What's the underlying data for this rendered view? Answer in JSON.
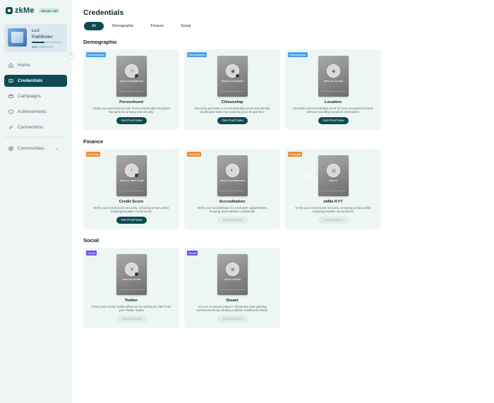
{
  "app": {
    "logo_text": "zkMe",
    "logo_badge": "Identity Hub"
  },
  "profile": {
    "level": "Lv.3",
    "rank": "Pathfinder",
    "xp_current": "423",
    "xp_total": "/1000 EXP",
    "xp_progress": 0.42
  },
  "sidebar": {
    "items": [
      {
        "label": "Home",
        "icon": "home-icon"
      },
      {
        "label": "Credentials",
        "icon": "id-card-icon"
      },
      {
        "label": "Campaigns",
        "icon": "flag-icon"
      },
      {
        "label": "Achievements",
        "icon": "shield-icon"
      },
      {
        "label": "Connections",
        "icon": "link-icon"
      }
    ],
    "communities": {
      "label": "Communities",
      "icon": "globe-icon"
    }
  },
  "page": {
    "title": "Credentials",
    "tabs": [
      "All",
      "Demographic",
      "Finance",
      "Social"
    ],
    "active_tab": "All"
  },
  "sections": [
    {
      "title": "Demographic",
      "cards": [
        {
          "tag": "Demographic",
          "sbt_label": "PROOF OF PERSONHOOD",
          "name": "Personhood",
          "desc": "Verify your personhood with homomorphically encrypted faceprint for privacy and security",
          "button": "Get Proof Now",
          "enabled": true
        },
        {
          "tag": "Demographic",
          "sbt_label": "PROOF OF CITIZENSHIP",
          "name": "Citizenship",
          "desc": "Securely generate a zero-knowledge proof and Identity Soulbound Token by scanning your ID and face",
          "button": "Get Proof Now",
          "enabled": true
        },
        {
          "tag": "Demographic",
          "sbt_label": "PROOF OF LOCATION",
          "name": "Location",
          "desc": "Generate zero-knowledge proof for your encrypted location without revealing sensitive information",
          "button": "Get Proof Now",
          "enabled": true
        }
      ]
    },
    {
      "title": "Finance",
      "cards": [
        {
          "tag": "Financial",
          "sbt_label": "PROOF OF CREDIT SCORE",
          "name": "Credit Score",
          "desc": "Verify your credit score securely, ensuring privacy while enjoying broader convenience",
          "button": "Get Proof Now",
          "enabled": true
        },
        {
          "tag": "Financial",
          "sbt_label": "PROOF OF ACCREDITATION",
          "name": "Accreditation",
          "desc": "Verify your accreditation for exclusive opportunities, keeping asset details confidential",
          "button": "Coming soon",
          "enabled": false
        },
        {
          "tag": "Financial",
          "sbt_label": "zkMe KYT",
          "name": "zkMe KYT",
          "desc": "Verify your credit score securely, ensuring privacy while enjoying broader convenience",
          "button": "Coming soon",
          "enabled": false,
          "ghost": "KYT"
        }
      ]
    },
    {
      "title": "Social",
      "cards": [
        {
          "tag": "Social",
          "sbt_label": "PROOF OF TWITTER",
          "name": "Twitter",
          "desc": "Prove your social media influence by minting an SBT from your Twitter status",
          "button": "Coming soon",
          "enabled": false
        },
        {
          "tag": "Social",
          "sbt_label": "PROOF OF STEAM",
          "name": "Steam",
          "desc": "Are you a veteran player? Showcase your gaming achievements by minting a Steam Soulbound Token",
          "button": "Coming soon",
          "enabled": false
        }
      ]
    }
  ],
  "colors": {
    "primary": "#0d4a52",
    "card_bg": "#eef6f4",
    "tag_demographic": "#4a9fe8",
    "tag_financial": "#f08a2c",
    "tag_social": "#6a52e8"
  }
}
